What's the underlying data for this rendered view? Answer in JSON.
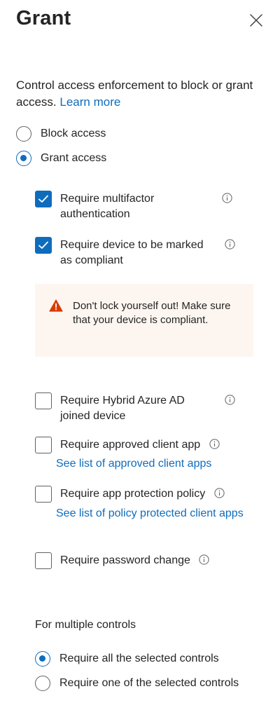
{
  "panel": {
    "title": "Grant",
    "close_icon": "close-icon"
  },
  "description": {
    "text": "Control access enforcement to block or grant access.",
    "link": "Learn more"
  },
  "access_options": [
    {
      "label": "Block access",
      "selected": false
    },
    {
      "label": "Grant access",
      "selected": true
    }
  ],
  "controls": [
    {
      "label_line1": "Require multifactor",
      "label_line2": "authentication",
      "checked": true,
      "info_icon": "info-icon"
    },
    {
      "label_line1": "Require device to be marked",
      "label_line2": "as compliant",
      "checked": true,
      "info_icon": "info-icon"
    },
    {
      "label_line1": "Require Hybrid Azure AD",
      "label_line2": "joined device",
      "checked": false,
      "info_icon": "info-icon"
    },
    {
      "label": "Require approved client app",
      "link": "See list of approved client apps",
      "checked": false,
      "info_icon": "info-icon"
    },
    {
      "label": "Require app protection policy",
      "link": "See list of policy protected client apps",
      "checked": false,
      "info_icon": "info-icon"
    },
    {
      "label": "Require password change",
      "checked": false,
      "info_icon": "info-icon"
    }
  ],
  "warning": {
    "icon": "warning-icon",
    "text": "Don't lock yourself out! Make sure that your device is compliant.",
    "color": "#d83b01"
  },
  "multiple_controls": {
    "heading": "For multiple controls",
    "options": [
      {
        "label": "Require all the selected controls",
        "selected": true
      },
      {
        "label": "Require one of the selected controls",
        "selected": false
      }
    ]
  },
  "colors": {
    "accent": "#0f6cbd",
    "text": "#242424",
    "warning_bg": "#fdf6f0"
  }
}
